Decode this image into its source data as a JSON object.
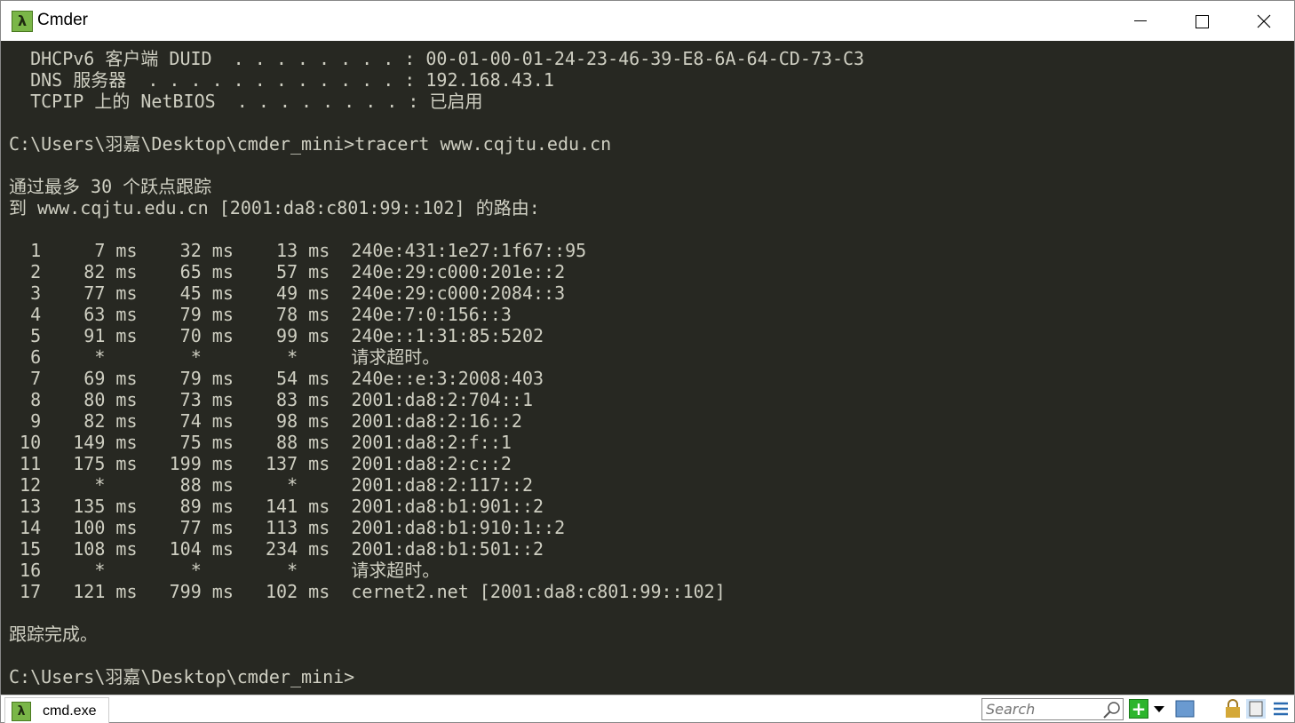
{
  "window": {
    "title": "Cmder",
    "app_icon": "lambda-icon"
  },
  "console": {
    "lines": [
      "  DHCPv6 客户端 DUID  . . . . . . . . : 00-01-00-01-24-23-46-39-E8-6A-64-CD-73-C3",
      "  DNS 服务器  . . . . . . . . . . . . : 192.168.43.1",
      "  TCPIP 上的 NetBIOS  . . . . . . . . : 已启用",
      "",
      "C:\\Users\\羽嘉\\Desktop\\cmder_mini>tracert www.cqjtu.edu.cn",
      "",
      "通过最多 30 个跃点跟踪",
      "到 www.cqjtu.edu.cn [2001:da8:c801:99::102] 的路由:",
      "",
      "  1     7 ms    32 ms    13 ms  240e:431:1e27:1f67::95",
      "  2    82 ms    65 ms    57 ms  240e:29:c000:201e::2",
      "  3    77 ms    45 ms    49 ms  240e:29:c000:2084::3",
      "  4    63 ms    79 ms    78 ms  240e:7:0:156::3",
      "  5    91 ms    70 ms    99 ms  240e::1:31:85:5202",
      "  6     *        *        *     请求超时。",
      "  7    69 ms    79 ms    54 ms  240e::e:3:2008:403",
      "  8    80 ms    73 ms    83 ms  2001:da8:2:704::1",
      "  9    82 ms    74 ms    98 ms  2001:da8:2:16::2",
      " 10   149 ms    75 ms    88 ms  2001:da8:2:f::1",
      " 11   175 ms   199 ms   137 ms  2001:da8:2:c::2",
      " 12     *       88 ms     *     2001:da8:2:117::2",
      " 13   135 ms    89 ms   141 ms  2001:da8:b1:901::2",
      " 14   100 ms    77 ms   113 ms  2001:da8:b1:910:1::2",
      " 15   108 ms   104 ms   234 ms  2001:da8:b1:501::2",
      " 16     *        *        *     请求超时。",
      " 17   121 ms   799 ms   102 ms  cernet2.net [2001:da8:c801:99::102]",
      "",
      "跟踪完成。",
      "",
      "C:\\Users\\羽嘉\\Desktop\\cmder_mini>"
    ]
  },
  "statusbar": {
    "tab_label": "cmd.exe",
    "search_placeholder": "Search",
    "add_label": "+"
  },
  "colors": {
    "console_bg": "#272822",
    "console_fg": "#cfcfc2",
    "accent": "#7ab648"
  }
}
